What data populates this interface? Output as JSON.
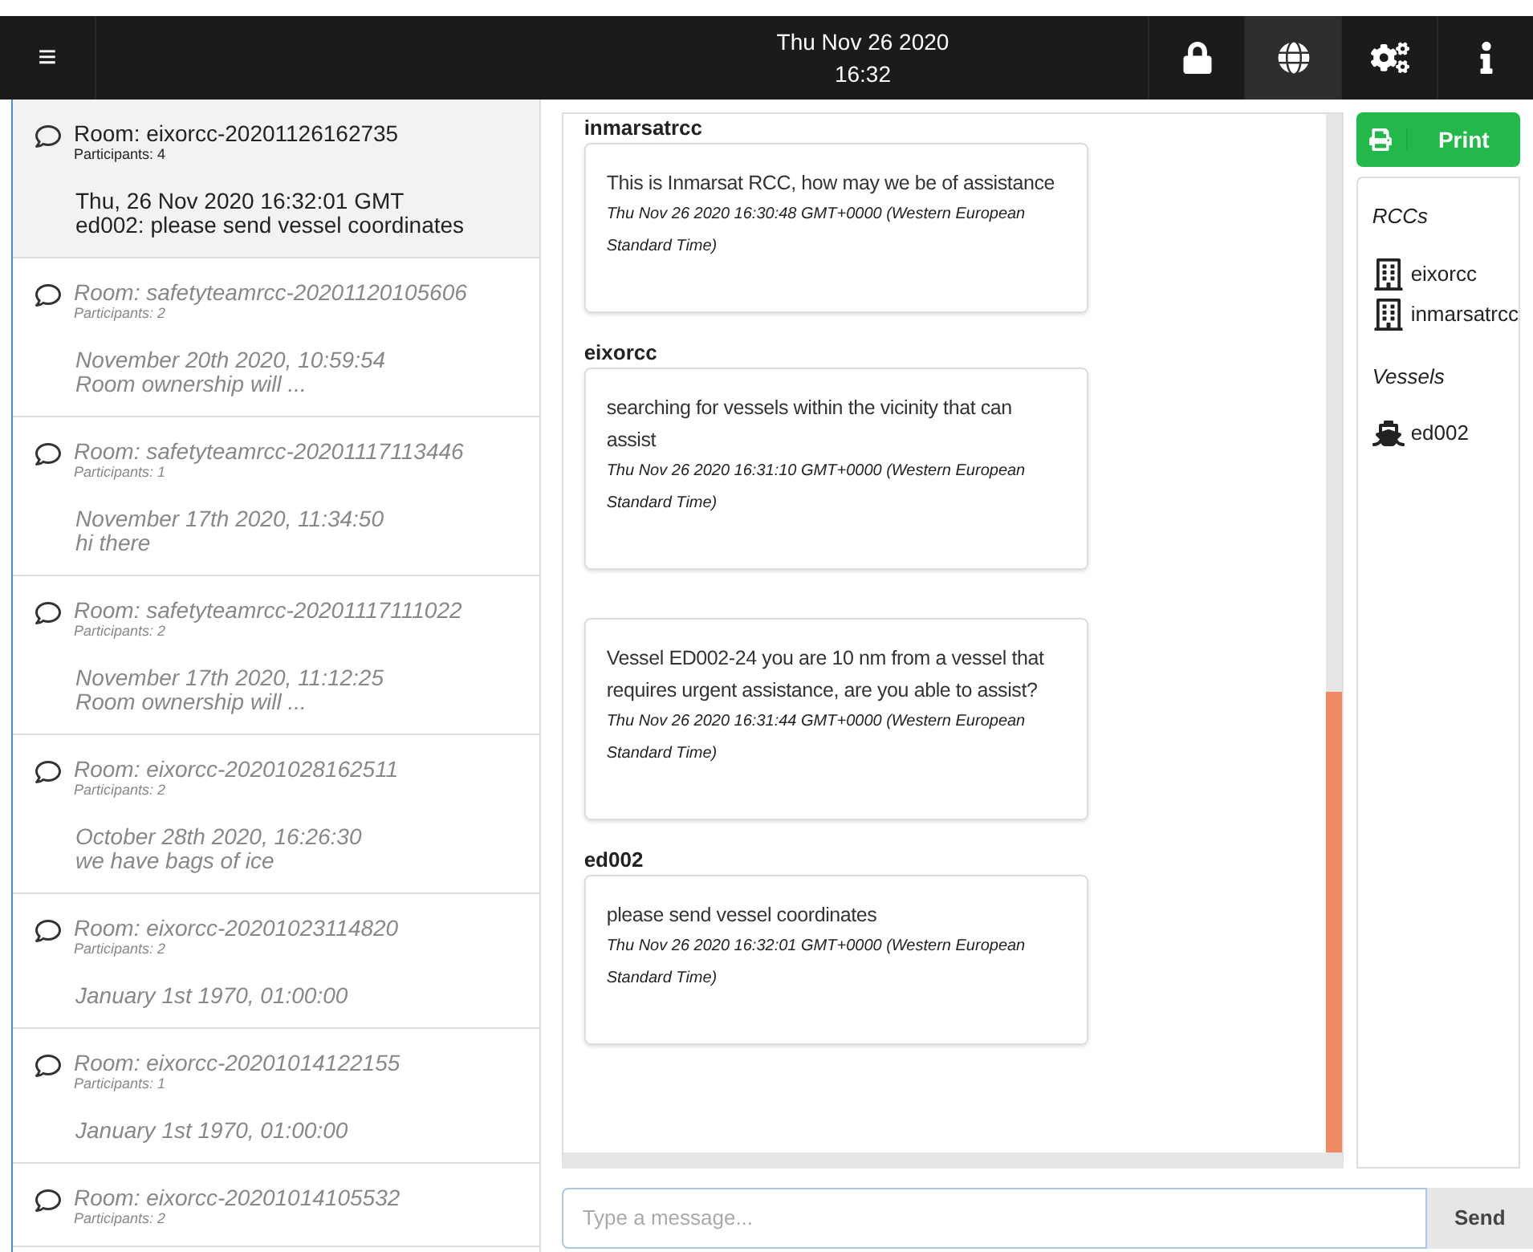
{
  "header": {
    "menu_icon": "≡",
    "date": "Thu Nov 26 2020",
    "time": "16:32",
    "icons": [
      {
        "kind": "lock",
        "selected": false
      },
      {
        "kind": "globe",
        "selected": true
      },
      {
        "kind": "gears",
        "selected": false
      },
      {
        "kind": "info",
        "selected": false
      }
    ]
  },
  "rooms": [
    {
      "title": "Room: eixorcc-20201126162735",
      "participants": "Participants: 4",
      "date": "Thu, 26 Nov 2020 16:32:01 GMT",
      "preview": "ed002: please send vessel coordinates",
      "selected": true
    },
    {
      "title": "Room: safetyteamrcc-20201120105606",
      "participants": "Participants: 2",
      "date": "November 20th 2020, 10:59:54",
      "preview": "Room ownership will ...",
      "selected": false
    },
    {
      "title": "Room: safetyteamrcc-20201117113446",
      "participants": "Participants: 1",
      "date": "November 17th 2020, 11:34:50",
      "preview": "hi there",
      "selected": false
    },
    {
      "title": "Room: safetyteamrcc-20201117111022",
      "participants": "Participants: 2",
      "date": "November 17th 2020, 11:12:25",
      "preview": "Room ownership will ...",
      "selected": false
    },
    {
      "title": "Room: eixorcc-20201028162511",
      "participants": "Participants: 2",
      "date": "October 28th 2020, 16:26:30",
      "preview": "we have bags of ice",
      "selected": false
    },
    {
      "title": "Room: eixorcc-20201023114820",
      "participants": "Participants: 2",
      "date": "January 1st 1970, 01:00:00",
      "selected": false
    },
    {
      "title": "Room: eixorcc-20201014122155",
      "participants": "Participants: 1",
      "date": "January 1st 1970, 01:00:00",
      "selected": false
    },
    {
      "title": "Room: eixorcc-20201014105532",
      "participants": "Participants: 2",
      "selected": false
    }
  ],
  "messages": [
    {
      "sender": "inmarsatrcc",
      "text": "This is Inmarsat RCC, how may we be of assistance",
      "timestamp": "Thu Nov 26 2020 16:30:48 GMT+0000 (Western European Standard Time)"
    },
    {
      "sender": "eixorcc",
      "text": "searching for vessels within the vicinity that can assist",
      "timestamp": "Thu Nov 26 2020 16:31:10 GMT+0000 (Western European Standard Time)"
    },
    {
      "text": "Vessel ED002-24 you are 10 nm from a vessel that requires urgent assistance, are you able to assist?",
      "timestamp": "Thu Nov 26 2020 16:31:44 GMT+0000 (Western European Standard Time)"
    },
    {
      "sender": "ed002",
      "text": "please send vessel coordinates",
      "timestamp": "Thu Nov 26 2020 16:32:01 GMT+0000 (Western European Standard Time)"
    }
  ],
  "composer": {
    "placeholder": "Type a message...",
    "send": "Send"
  },
  "print_button": "Print",
  "participants": [
    {
      "heading": "RCCs",
      "members": [
        {
          "name": "eixorcc",
          "kind": "building"
        },
        {
          "name": "inmarsatrcc",
          "kind": "building"
        }
      ]
    },
    {
      "heading": "Vessels",
      "members": [
        {
          "name": "ed002",
          "kind": "ship"
        }
      ]
    }
  ]
}
